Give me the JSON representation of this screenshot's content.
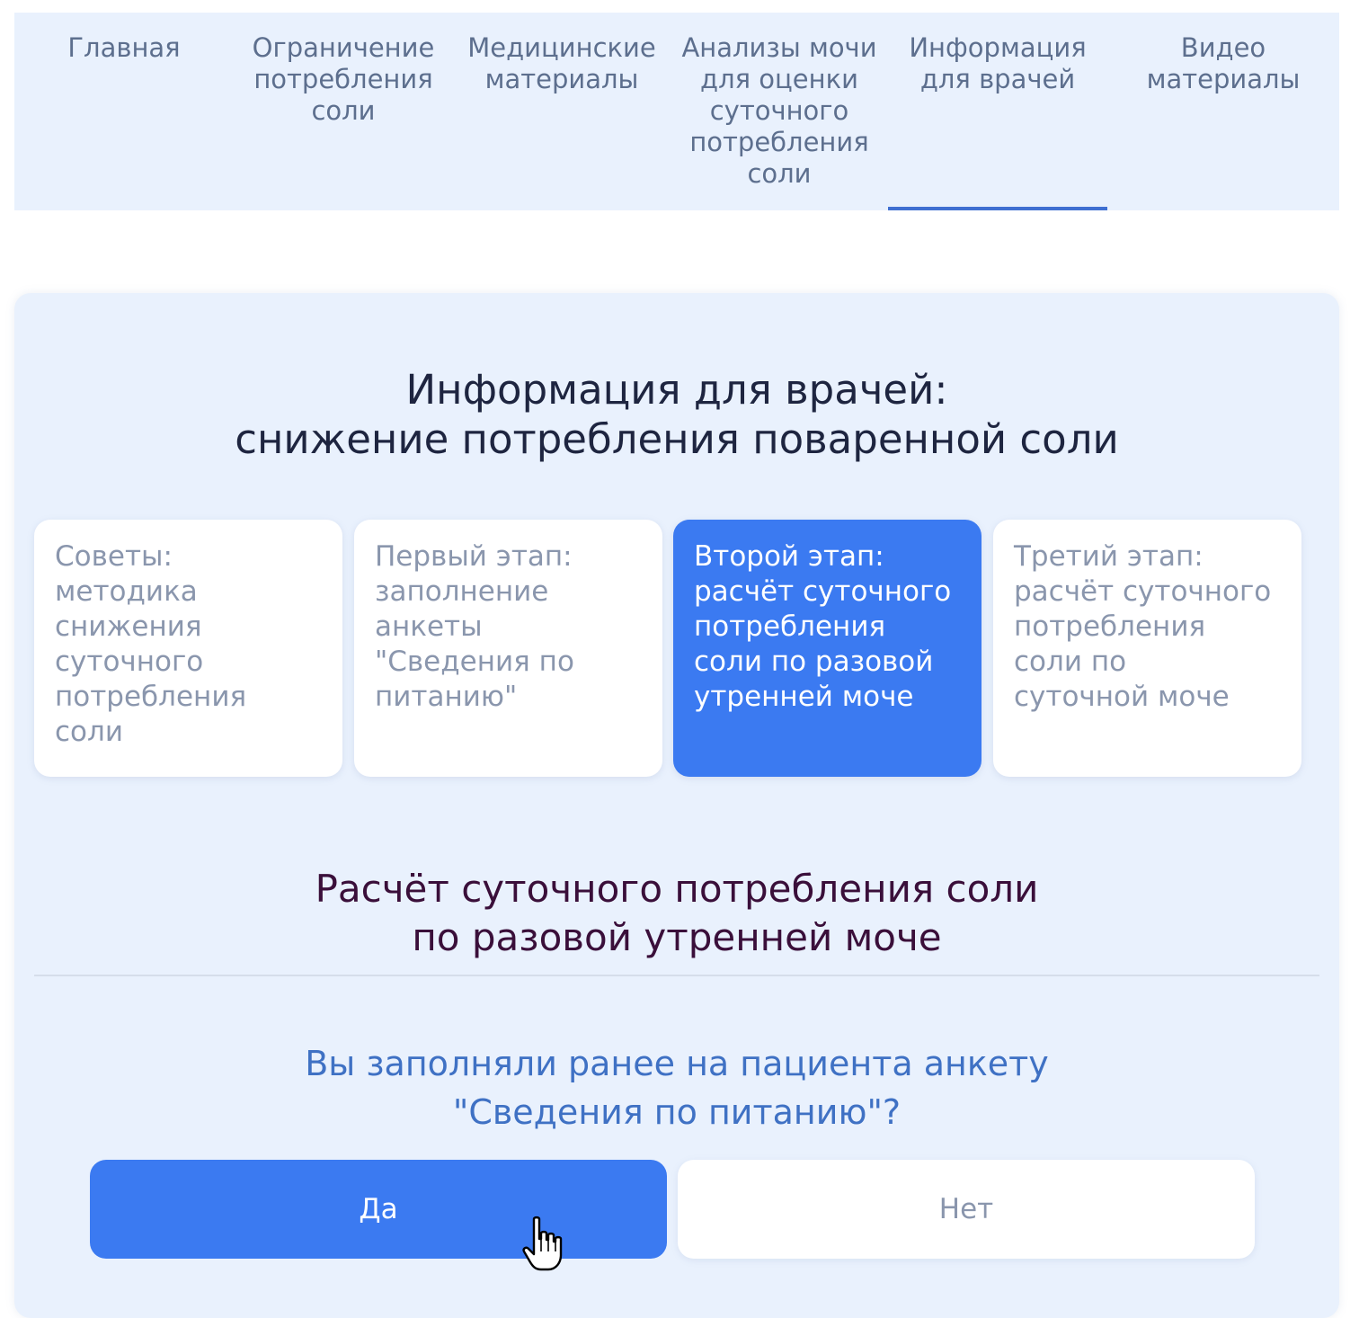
{
  "nav": {
    "items": [
      {
        "label": "Главная",
        "active": false
      },
      {
        "label": "Ограничение\nпотребления\nсоли",
        "active": false
      },
      {
        "label": "Медицинские\nматериалы",
        "active": false
      },
      {
        "label": "Анализы мочи\nдля оценки\nсуточного\nпотребления\nсоли",
        "active": false
      },
      {
        "label": "Информация\nдля врачей",
        "active": true
      },
      {
        "label": "Видео\nматериалы",
        "active": false
      }
    ]
  },
  "main": {
    "title_line1": "Информация для врачей:",
    "title_line2": "снижение потребления поваренной соли",
    "steps": [
      {
        "label": "Советы:\nметодика\nснижения\nсуточного\nпотребления\nсоли",
        "active": false
      },
      {
        "label": "Первый этап:\nзаполнение\nанкеты\n\"Сведения по\nпитанию\"",
        "active": false
      },
      {
        "label": "Второй этап:\nрасчёт суточного\nпотребления\nсоли по разовой\nутренней моче",
        "active": true
      },
      {
        "label": "Третий этап:\nрасчёт суточного\nпотребления\nсоли по\nсуточной моче",
        "active": false
      }
    ],
    "section_title_line1": "Расчёт суточного потребления соли",
    "section_title_line2": "по разовой утренней моче",
    "question_line1": "Вы заполняли ранее на пациента анкету",
    "question_line2": "\"Сведения по питанию\"?",
    "yes_label": "Да",
    "no_label": "Нет"
  },
  "colors": {
    "panel_bg": "#e9f1fd",
    "accent": "#3b7af1",
    "nav_underline": "#3f6fd1",
    "question_text": "#3f71c4",
    "section_title_text": "#3a0f3a"
  },
  "icons": {
    "cursor": "hand-pointer-icon"
  }
}
